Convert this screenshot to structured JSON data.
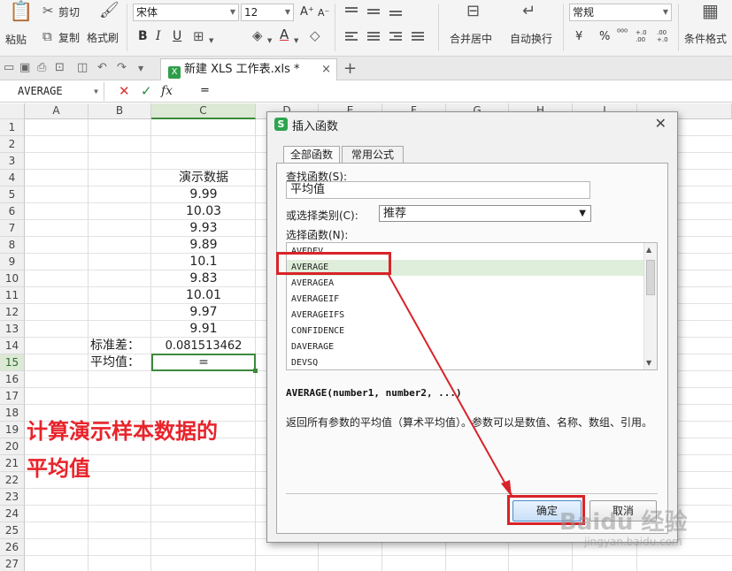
{
  "ribbon": {
    "paste_label": "粘贴",
    "cut_label": "剪切",
    "copy_label": "复制",
    "format_painter_label": "格式刷",
    "font_name": "宋体",
    "font_size": "12",
    "font_grow": "A⁺",
    "font_shrink": "A⁻",
    "bold": "B",
    "italic": "I",
    "underline": "U",
    "font_color_glyph": "A",
    "merge_center_label": "合并居中",
    "wrap_text_label": "自动换行",
    "number_format": "常规",
    "currency_glyph": "¥",
    "percent_glyph": "%",
    "thousands_glyph": "⁰⁰⁰",
    "inc_decimal_glyph": "+.0 .00",
    "dec_decimal_glyph": ".00 +.0",
    "conditional_format_label": "条件格式"
  },
  "tabbar": {
    "doc_tab": "新建 XLS 工作表.xls *",
    "xls_logo": "X",
    "close": "×",
    "new_tab": "+"
  },
  "formula_bar": {
    "name_box": "AVERAGE",
    "fx": "fx",
    "content": "="
  },
  "grid": {
    "columns": [
      "A",
      "B",
      "C",
      "D",
      "E",
      "F",
      "G",
      "H",
      "I"
    ],
    "active_column": "C",
    "rows": [
      "1",
      "2",
      "3",
      "4",
      "5",
      "6",
      "7",
      "8",
      "9",
      "10",
      "11",
      "12",
      "13",
      "14",
      "15",
      "16",
      "17",
      "18",
      "19",
      "20",
      "21",
      "22",
      "23",
      "24",
      "25",
      "26",
      "27"
    ],
    "active_row": "15",
    "header_cell": "演示数据",
    "values": [
      "9.99",
      "10.03",
      "9.93",
      "9.89",
      "10.1",
      "9.83",
      "10.01",
      "9.97",
      "9.91"
    ],
    "stdev_label": "标准差：",
    "stdev_value": "0.081513462",
    "avg_label": "平均值：",
    "avg_value": "="
  },
  "annotation": {
    "line1": "计算演示样本数据的",
    "line2": "平均值"
  },
  "dialog": {
    "logo": "S",
    "title": "插入函数",
    "close": "✕",
    "tabs": [
      "全部函数",
      "常用公式"
    ],
    "search_label": "查找函数(S):",
    "search_value": "平均值",
    "category_label": "或选择类别(C):",
    "category_value": "推荐",
    "function_list_label": "选择函数(N):",
    "functions": [
      "AVEDEV",
      "AVERAGE",
      "AVERAGEA",
      "AVERAGEIF",
      "AVERAGEIFS",
      "CONFIDENCE",
      "DAVERAGE",
      "DEVSQ"
    ],
    "selected_function": "AVERAGE",
    "syntax": "AVERAGE(number1, number2, ...)",
    "description": "返回所有参数的平均值（算术平均值）。参数可以是数值、名称、数组、引用。",
    "ok_label": "确定",
    "cancel_label": "取消"
  },
  "watermark": {
    "brand": "Baidu 经验",
    "url": "jingyan.baidu.com"
  },
  "colors": {
    "accent_green": "#3c8a3c",
    "annotation_red": "#e8232a",
    "selected_row": "#dfeeda"
  }
}
